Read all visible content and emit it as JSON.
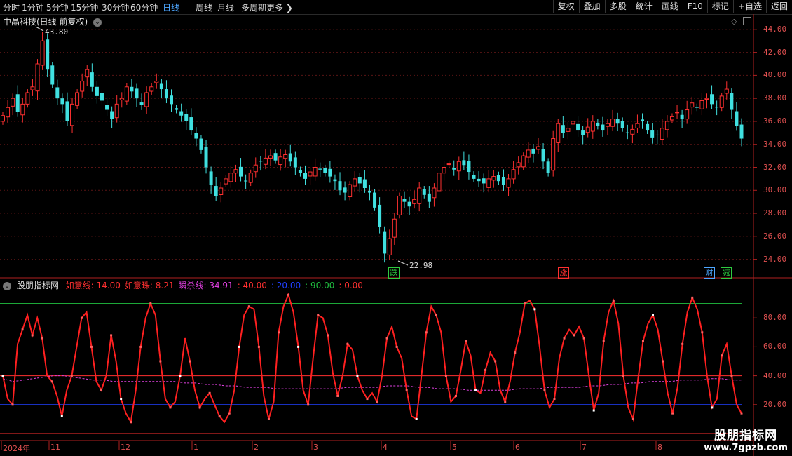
{
  "toolbar": {
    "left": [
      {
        "label": "分时",
        "active": false
      },
      {
        "label": "1分钟",
        "active": false
      },
      {
        "label": "5分钟",
        "active": false
      },
      {
        "label": "15分钟",
        "active": false
      },
      {
        "label": "30分钟",
        "active": false
      },
      {
        "label": "60分钟",
        "active": false
      },
      {
        "label": "日线",
        "active": true
      },
      {
        "label": "周线",
        "active": false
      },
      {
        "label": "月线",
        "active": false
      },
      {
        "label": "多周期",
        "active": false
      },
      {
        "label": "更多 ❯",
        "active": false
      }
    ],
    "right": [
      "复权",
      "叠加",
      "多股",
      "统计",
      "画线",
      "F10",
      "标记",
      "+自选",
      "返回"
    ]
  },
  "price_panel": {
    "title": "中晶科技(日线 前复权)",
    "high_label": "43.80",
    "low_label": "22.98",
    "y_ticks": [
      "44.00",
      "42.00",
      "40.00",
      "38.00",
      "36.00",
      "34.00",
      "32.00",
      "30.00",
      "28.00",
      "26.00",
      "24.00"
    ],
    "badges": [
      {
        "text": "跌",
        "color": "#2ecc40"
      },
      {
        "text": "涨",
        "color": "#ff3030"
      },
      {
        "text": "财",
        "color": "#4da6ff"
      },
      {
        "text": "减",
        "color": "#2ecc40"
      }
    ],
    "up_color": "#ff3030",
    "down_color": "#40e0e0"
  },
  "indicator_panel": {
    "name": "股朋指标网",
    "items": [
      {
        "label": "如意线: 14.00",
        "color": "#ff3030"
      },
      {
        "label": "如意珠: 8.21",
        "color": "#ff3030"
      },
      {
        "label": "瞬杀线: 34.91",
        "color": "#e040e0"
      },
      {
        "label": ": 40.00",
        "color": "#ff3030"
      },
      {
        "label": ": 20.00",
        "color": "#2040ff"
      },
      {
        "label": ": 90.00",
        "color": "#20c040"
      },
      {
        "label": ": 0.00",
        "color": "#ff3030"
      }
    ],
    "y_ticks": [
      "80.00",
      "60.00",
      "40.00",
      "20.00"
    ]
  },
  "x_axis": {
    "labels": [
      "2024年",
      "11",
      "12",
      "1",
      "2",
      "3",
      "4",
      "5",
      "6",
      "7",
      "8"
    ]
  },
  "watermark": {
    "title": "股朋指标网",
    "url": "www.7gpzb.com"
  },
  "chart_data": {
    "type": "candlestick+line",
    "price_range": [
      22.98,
      43.8
    ],
    "close_series_approx": [
      36.5,
      37.2,
      38.0,
      36.8,
      37.5,
      38.5,
      39.0,
      41.0,
      43.0,
      40.5,
      39.2,
      38.0,
      37.5,
      36.0,
      37.5,
      38.5,
      39.5,
      40.5,
      39.0,
      38.2,
      37.8,
      37.0,
      36.2,
      37.5,
      38.0,
      39.0,
      38.6,
      38.0,
      37.4,
      38.5,
      39.0,
      39.5,
      38.8,
      38.0,
      37.5,
      37.0,
      36.5,
      36.0,
      35.2,
      34.5,
      33.5,
      32.0,
      30.5,
      29.5,
      30.2,
      31.0,
      31.5,
      31.8,
      31.2,
      30.8,
      31.5,
      32.2,
      32.5,
      32.8,
      33.0,
      32.6,
      32.9,
      33.1,
      32.5,
      32.0,
      31.5,
      31.0,
      31.6,
      32.0,
      31.8,
      31.5,
      31.2,
      30.8,
      30.0,
      29.8,
      30.5,
      31.0,
      30.6,
      30.2,
      29.8,
      28.5,
      26.8,
      24.5,
      25.8,
      27.5,
      29.5,
      29.0,
      28.6,
      29.2,
      30.2,
      29.6,
      29.0,
      30.2,
      31.5,
      32.0,
      32.3,
      31.8,
      32.5,
      32.2,
      31.6,
      31.0,
      30.8,
      30.6,
      31.0,
      31.2,
      30.8,
      30.5,
      31.0,
      31.8,
      32.4,
      33.0,
      33.5,
      33.2,
      33.8,
      32.5,
      31.5,
      34.5,
      35.8,
      35.0,
      35.4,
      36.0,
      35.2,
      34.8,
      35.5,
      36.0,
      35.6,
      35.2,
      35.8,
      36.2,
      35.8,
      35.4,
      35.0,
      35.3,
      35.8,
      36.0,
      35.2,
      34.6,
      34.8,
      35.4,
      36.0,
      36.4,
      36.8,
      36.2,
      37.0,
      37.6,
      37.2,
      37.8,
      38.0,
      37.5,
      37.2,
      38.2,
      38.8,
      37.0,
      35.6,
      34.5
    ],
    "ruyi_line_approx": [
      40,
      24,
      20,
      62,
      72,
      82,
      68,
      80,
      66,
      40,
      36,
      26,
      12,
      30,
      40,
      60,
      80,
      84,
      60,
      36,
      30,
      40,
      68,
      50,
      24,
      14,
      8,
      30,
      60,
      80,
      90,
      82,
      50,
      24,
      18,
      22,
      40,
      66,
      50,
      30,
      18,
      24,
      28,
      20,
      12,
      8,
      14,
      30,
      60,
      82,
      88,
      86,
      60,
      26,
      10,
      22,
      70,
      88,
      96,
      84,
      60,
      30,
      20,
      52,
      82,
      80,
      68,
      42,
      26,
      40,
      62,
      58,
      40,
      30,
      24,
      28,
      22,
      40,
      66,
      74,
      60,
      52,
      30,
      12,
      10,
      40,
      70,
      88,
      82,
      70,
      40,
      22,
      26,
      44,
      64,
      54,
      30,
      28,
      44,
      56,
      50,
      30,
      22,
      36,
      56,
      70,
      90,
      92,
      86,
      60,
      30,
      18,
      24,
      52,
      66,
      72,
      68,
      74,
      66,
      40,
      16,
      28,
      64,
      84,
      92,
      76,
      40,
      18,
      10,
      38,
      64,
      76,
      82,
      72,
      50,
      28,
      14,
      32,
      62,
      84,
      94,
      86,
      70,
      40,
      18,
      24,
      54,
      62,
      40,
      20,
      14
    ],
    "shunsha_line_approx": [
      38,
      36,
      37,
      38,
      39,
      40,
      40,
      39,
      38,
      37,
      37,
      36,
      36,
      36,
      36,
      36,
      36,
      36,
      35,
      35,
      34,
      34,
      33,
      33,
      32,
      32,
      32,
      31,
      31,
      31,
      31,
      31,
      31,
      31,
      32,
      32,
      32,
      32,
      33,
      33,
      33,
      32,
      32,
      31,
      31,
      31,
      30,
      30,
      30,
      30,
      30,
      31,
      31,
      31,
      32,
      32,
      32,
      32,
      33,
      33,
      34,
      34,
      35,
      35,
      36,
      36,
      36,
      37,
      37,
      37,
      38,
      38,
      37,
      37
    ],
    "ref_lines": [
      {
        "value": 90,
        "color": "#20c040"
      },
      {
        "value": 40,
        "color": "#ff3030"
      },
      {
        "value": 20,
        "color": "#2040ff"
      },
      {
        "value": 0,
        "color": "#ff3030"
      }
    ],
    "indicator_range": [
      0,
      100
    ]
  }
}
